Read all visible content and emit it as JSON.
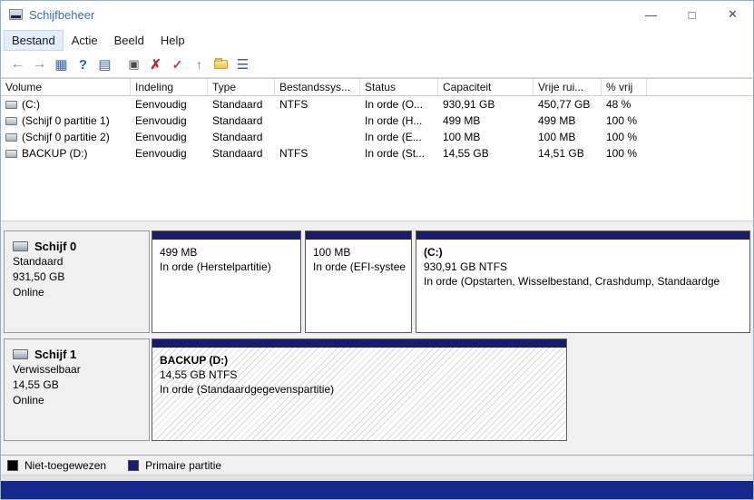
{
  "window": {
    "title": "Schijfbeheer",
    "controls": {
      "minimize": "—",
      "maximize": "□",
      "close": "✕"
    }
  },
  "menu": {
    "items": [
      {
        "label": "Bestand"
      },
      {
        "label": "Actie"
      },
      {
        "label": "Beeld"
      },
      {
        "label": "Help"
      }
    ]
  },
  "toolbar": {
    "icons": [
      {
        "name": "back",
        "glyph": "←"
      },
      {
        "name": "forward",
        "glyph": "→"
      },
      {
        "name": "console-window",
        "glyph": "▦"
      },
      {
        "name": "help",
        "glyph": "?"
      },
      {
        "name": "details-view",
        "glyph": "▤"
      },
      {
        "name": "disk-properties",
        "glyph": "▣"
      },
      {
        "name": "delete-volume",
        "glyph": "✗"
      },
      {
        "name": "mark-partition",
        "glyph": "✓"
      },
      {
        "name": "extend-volume",
        "glyph": "↑"
      },
      {
        "name": "open-folder-tools",
        "glyph": ""
      },
      {
        "name": "list-view",
        "glyph": "☰"
      }
    ]
  },
  "table": {
    "columns": [
      "Volume",
      "Indeling",
      "Type",
      "Bestandssys...",
      "Status",
      "Capaciteit",
      "Vrije rui...",
      "% vrij"
    ],
    "rows": [
      {
        "volume": "(C:)",
        "indeling": "Eenvoudig",
        "type": "Standaard",
        "fs": "NTFS",
        "status": "In orde (O...",
        "capaciteit": "930,91 GB",
        "vrij": "450,77 GB",
        "pct": "48 %"
      },
      {
        "volume": "(Schijf 0 partitie 1)",
        "indeling": "Eenvoudig",
        "type": "Standaard",
        "fs": "",
        "status": "In orde (H...",
        "capaciteit": "499 MB",
        "vrij": "499 MB",
        "pct": "100 %"
      },
      {
        "volume": "(Schijf 0 partitie 2)",
        "indeling": "Eenvoudig",
        "type": "Standaard",
        "fs": "",
        "status": "In orde (E...",
        "capaciteit": "100 MB",
        "vrij": "100 MB",
        "pct": "100 %"
      },
      {
        "volume": "BACKUP (D:)",
        "indeling": "Eenvoudig",
        "type": "Standaard",
        "fs": "NTFS",
        "status": "In orde (St...",
        "capaciteit": "14,55 GB",
        "vrij": "14,51 GB",
        "pct": "100 %"
      }
    ]
  },
  "disks": [
    {
      "name": "Schijf 0",
      "kind": "Standaard",
      "size": "931,50 GB",
      "status": "Online",
      "partitions": [
        {
          "name": "",
          "size": "499 MB",
          "state": "In orde (Herstelpartitie)"
        },
        {
          "name": "",
          "size": "100 MB",
          "state": "In orde (EFI-systee"
        },
        {
          "name": "(C:)",
          "size": "930,91 GB NTFS",
          "state": "In orde (Opstarten, Wisselbestand, Crashdump, Standaardge"
        }
      ]
    },
    {
      "name": "Schijf 1",
      "kind": "Verwisselbaar",
      "size": "14,55 GB",
      "status": "Online",
      "partitions": [
        {
          "name": "BACKUP  (D:)",
          "size": "14,55 GB NTFS",
          "state": "In orde (Standaardgegevenspartitie)"
        }
      ]
    }
  ],
  "legend": {
    "items": [
      {
        "label": "Niet-toegewezen",
        "color": "#000000"
      },
      {
        "label": "Primaire partitie",
        "color": "#1b1b6e"
      }
    ]
  },
  "colors": {
    "partition_header": "#1b1b6e",
    "unallocated": "#000000",
    "bottom_bar": "#13298c",
    "title_text": "#3f6fa8"
  }
}
